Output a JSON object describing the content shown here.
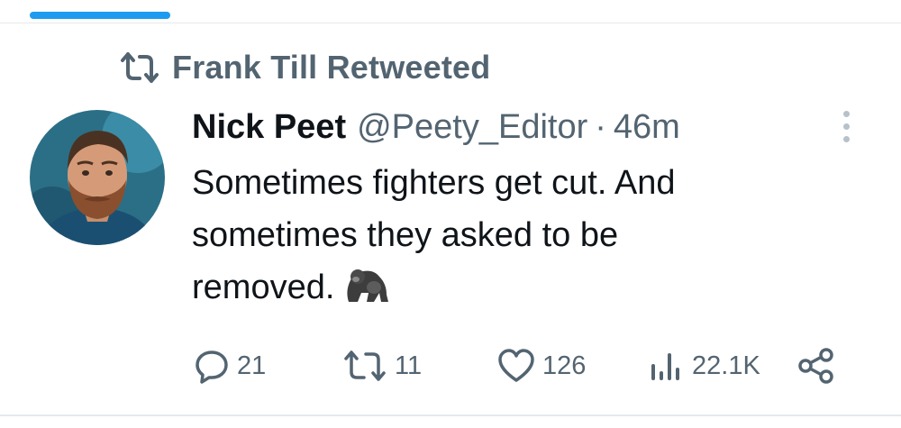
{
  "retweet": {
    "label": "Frank Till Retweeted"
  },
  "tweet": {
    "display_name": "Nick Peet",
    "handle": "@Peety_Editor",
    "separator": "·",
    "time": "46m",
    "text_lines": [
      "Sometimes fighters get cut. And",
      "sometimes they asked to be",
      "removed."
    ],
    "emoji": "gorilla"
  },
  "actions": {
    "replies": "21",
    "retweets": "11",
    "likes": "126",
    "views": "22.1K"
  },
  "icons": [
    "retweet-icon",
    "more-icon",
    "reply-icon",
    "like-icon",
    "views-icon",
    "share-icon"
  ],
  "colors": {
    "accent": "#1d9bf0",
    "secondary_text": "#536471",
    "primary_text": "#0f1419"
  }
}
